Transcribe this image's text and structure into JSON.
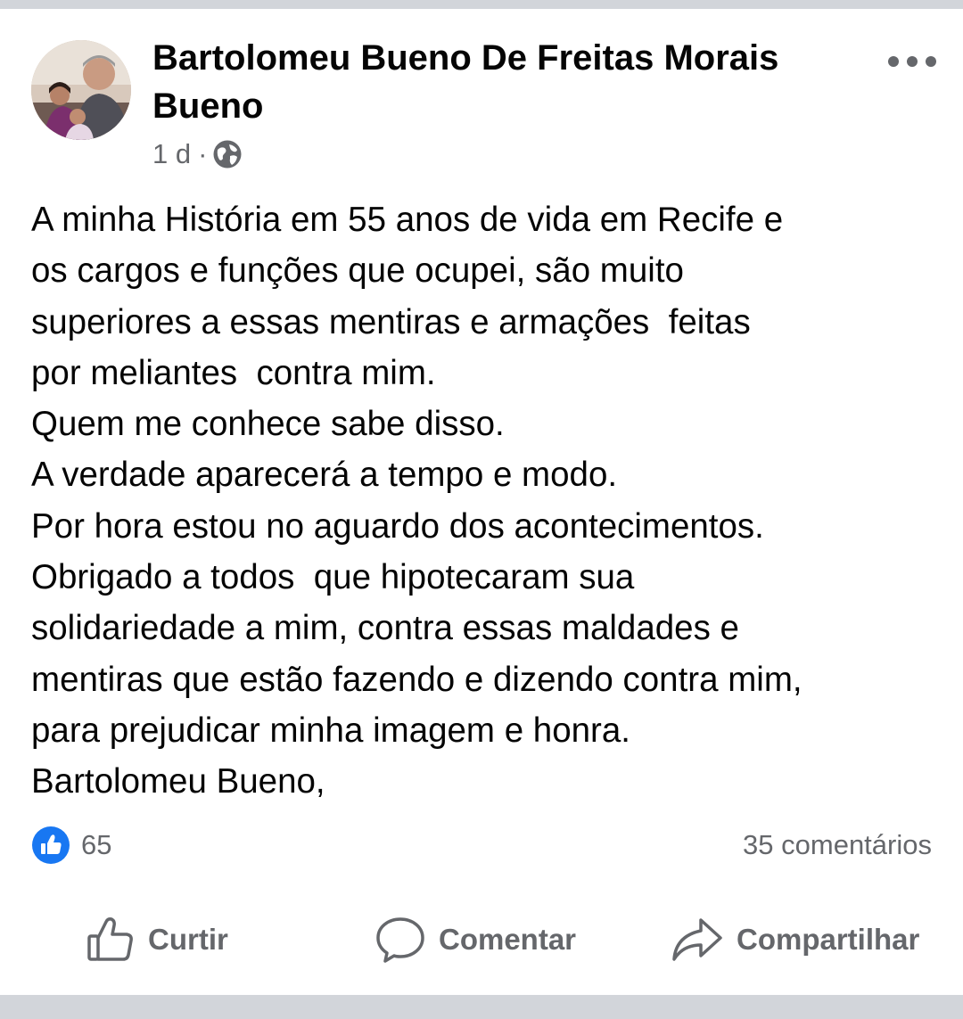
{
  "post": {
    "author": "Bartolomeu Bueno De Freitas Morais Bueno",
    "time": "1 d",
    "separator": "·",
    "audience_icon": "globe-icon",
    "more_icon": "more-horizontal-icon",
    "lines": [
      "A minha História em 55 anos de vida em Recife e",
      "os cargos e funções que ocupei, são muito",
      "superiores a essas mentiras e armações  feitas",
      "por meliantes  contra mim.",
      "Quem me conhece sabe disso.",
      "A verdade aparecerá a tempo e modo.",
      "Por hora estou no aguardo dos acontecimentos.",
      "Obrigado a todos  que hipotecaram sua",
      "solidariedade a mim, contra essas maldades e",
      "mentiras que estão fazendo e dizendo contra mim,",
      "para prejudicar minha imagem e honra.",
      "Bartolomeu Bueno,"
    ]
  },
  "stats": {
    "reaction_icon": "like-reaction-icon",
    "reaction_count": "65",
    "comments": "35 comentários"
  },
  "actions": {
    "like_label": "Curtir",
    "comment_label": "Comentar",
    "share_label": "Compartilhar"
  },
  "colors": {
    "like_blue": "#1877f2",
    "secondary_text": "#65676b",
    "divider": "#d2d5da"
  }
}
